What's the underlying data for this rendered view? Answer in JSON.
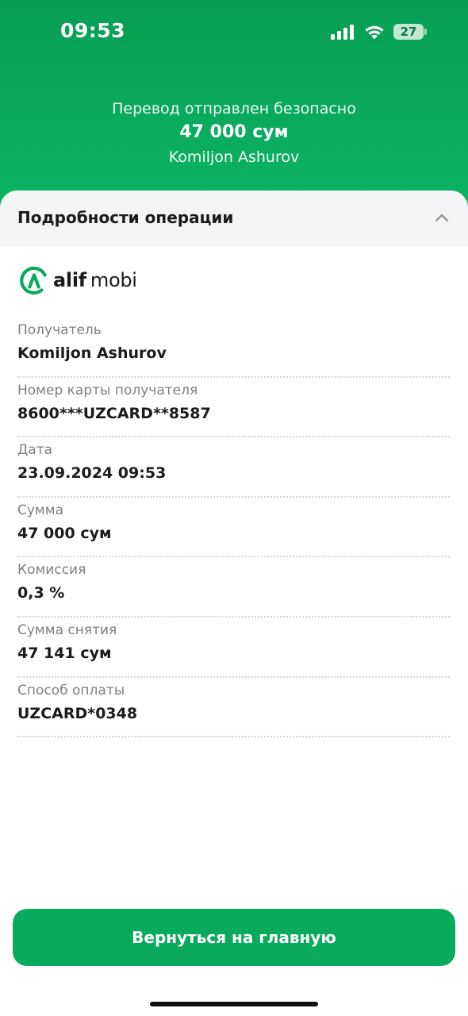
{
  "status_bar": {
    "time": "09:53",
    "battery_level": "27",
    "icons": [
      "signal-icon",
      "wifi-icon",
      "battery-icon"
    ]
  },
  "hero": {
    "subtitle": "Перевод отправлен безопасно",
    "amount": "47 000 сум",
    "recipient": "Komiljon Ashurov"
  },
  "section": {
    "title": "Подробности операции",
    "toggle_icon": "chevron-up-icon"
  },
  "logo": {
    "bold": "alif",
    "light": "mobi"
  },
  "details": [
    {
      "label": "Получатель",
      "value": "Komiljon Ashurov"
    },
    {
      "label": "Номер карты получателя",
      "value": "8600***UZCARD**8587"
    },
    {
      "label": "Дата",
      "value": "23.09.2024 09:53"
    },
    {
      "label": "Сумма",
      "value": "47 000 сум"
    },
    {
      "label": "Комиссия",
      "value": "0,3 %"
    },
    {
      "label": "Сумма снятия",
      "value": "47 141 сум"
    },
    {
      "label": "Способ оплаты",
      "value": "UZCARD*0348"
    }
  ],
  "footer": {
    "home_button_label": "Вернуться на главную"
  },
  "colors": {
    "brand_green": "#0aaa5d",
    "header_green_top": "#089e53",
    "section_header_bg": "#f3f4f6",
    "label_gray": "#7d7f85"
  }
}
